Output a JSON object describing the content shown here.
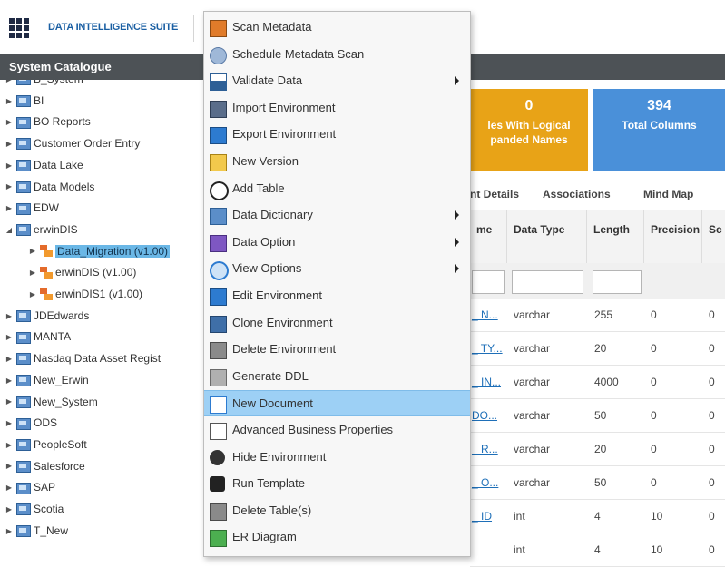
{
  "app": {
    "title": "DATA INTELLIGENCE SUITE"
  },
  "catalogue": {
    "title": "System Catalogue",
    "tree": [
      {
        "label": "B_System",
        "type": "folder",
        "depth": 0,
        "caret": "collapsed"
      },
      {
        "label": "BI",
        "type": "folder",
        "depth": 0,
        "caret": "collapsed"
      },
      {
        "label": "BO Reports",
        "type": "folder",
        "depth": 0,
        "caret": "collapsed"
      },
      {
        "label": "Customer Order Entry",
        "type": "folder",
        "depth": 0,
        "caret": "collapsed"
      },
      {
        "label": "Data Lake",
        "type": "folder",
        "depth": 0,
        "caret": "collapsed"
      },
      {
        "label": "Data Models",
        "type": "folder",
        "depth": 0,
        "caret": "collapsed"
      },
      {
        "label": "EDW",
        "type": "folder",
        "depth": 0,
        "caret": "collapsed"
      },
      {
        "label": "erwinDIS",
        "type": "folder",
        "depth": 0,
        "caret": "expanded"
      },
      {
        "label": "Data_Migration (v1.00)",
        "type": "model",
        "depth": 1,
        "caret": "collapsed",
        "selected": true
      },
      {
        "label": "erwinDIS (v1.00)",
        "type": "model",
        "depth": 1,
        "caret": "collapsed"
      },
      {
        "label": "erwinDIS1 (v1.00)",
        "type": "model",
        "depth": 1,
        "caret": "collapsed"
      },
      {
        "label": "JDEdwards",
        "type": "folder",
        "depth": 0,
        "caret": "collapsed"
      },
      {
        "label": "MANTA",
        "type": "folder",
        "depth": 0,
        "caret": "collapsed"
      },
      {
        "label": "Nasdaq Data Asset Regist",
        "type": "folder",
        "depth": 0,
        "caret": "collapsed"
      },
      {
        "label": "New_Erwin",
        "type": "folder",
        "depth": 0,
        "caret": "collapsed"
      },
      {
        "label": "New_System",
        "type": "folder",
        "depth": 0,
        "caret": "collapsed"
      },
      {
        "label": "ODS",
        "type": "folder",
        "depth": 0,
        "caret": "collapsed"
      },
      {
        "label": "PeopleSoft",
        "type": "folder",
        "depth": 0,
        "caret": "collapsed"
      },
      {
        "label": "Salesforce",
        "type": "folder",
        "depth": 0,
        "caret": "collapsed"
      },
      {
        "label": "SAP",
        "type": "folder",
        "depth": 0,
        "caret": "collapsed"
      },
      {
        "label": "Scotia",
        "type": "folder",
        "depth": 0,
        "caret": "collapsed"
      },
      {
        "label": "T_New",
        "type": "folder",
        "depth": 0,
        "caret": "collapsed"
      }
    ]
  },
  "cards": [
    {
      "number": "0",
      "caption_line1": "les With Logical",
      "caption_line2": "panded Names",
      "color": "#e8a317"
    },
    {
      "number": "394",
      "caption_line1": "Total Columns",
      "caption_line2": "",
      "color": "#4a90d9"
    }
  ],
  "tabs": [
    "nt Details",
    "Associations",
    "Mind Map"
  ],
  "table": {
    "headers": [
      "me",
      "Data Type",
      "Length",
      "Precision",
      "Sc"
    ],
    "rows": [
      [
        "_ N...",
        "varchar",
        "255",
        "0",
        "0"
      ],
      [
        "_ TY...",
        "varchar",
        "20",
        "0",
        "0"
      ],
      [
        "_ IN...",
        "varchar",
        "4000",
        "0",
        "0"
      ],
      [
        "DO...",
        "varchar",
        "50",
        "0",
        "0"
      ],
      [
        "_ R...",
        "varchar",
        "20",
        "0",
        "0"
      ],
      [
        "_ O...",
        "varchar",
        "50",
        "0",
        "0"
      ],
      [
        "_ ID",
        "int",
        "4",
        "10",
        "0"
      ],
      [
        "",
        "int",
        "4",
        "10",
        "0"
      ]
    ]
  },
  "context_menu": {
    "items": [
      {
        "label": "Scan Metadata",
        "icon": "scan-metadata-icon",
        "submenu": false
      },
      {
        "label": "Schedule Metadata Scan",
        "icon": "clock-icon",
        "submenu": false
      },
      {
        "label": "Validate Data",
        "icon": "bar-chart-icon",
        "submenu": true
      },
      {
        "label": "Import Environment",
        "icon": "import-icon",
        "submenu": false
      },
      {
        "label": "Export Environment",
        "icon": "export-icon",
        "submenu": false
      },
      {
        "label": "New Version",
        "icon": "new-version-icon",
        "submenu": false
      },
      {
        "label": "Add Table",
        "icon": "plus-circle-icon",
        "submenu": false
      },
      {
        "label": "Data Dictionary",
        "icon": "book-icon",
        "submenu": true
      },
      {
        "label": "Data Option",
        "icon": "checklist-icon",
        "submenu": true
      },
      {
        "label": "View Options",
        "icon": "magnifier-icon",
        "submenu": true
      },
      {
        "label": "Edit Environment",
        "icon": "edit-icon",
        "submenu": false
      },
      {
        "label": "Clone Environment",
        "icon": "monitor-icon",
        "submenu": false
      },
      {
        "label": "Delete Environment",
        "icon": "trash-icon",
        "submenu": false
      },
      {
        "label": "Generate DDL",
        "icon": "ddl-icon",
        "submenu": false
      },
      {
        "label": "New Document",
        "icon": "document-icon",
        "submenu": false,
        "highlighted": true
      },
      {
        "label": "Advanced Business Properties",
        "icon": "properties-icon",
        "submenu": false
      },
      {
        "label": "Hide Environment",
        "icon": "eye-icon",
        "submenu": false
      },
      {
        "label": "Run Template",
        "icon": "running-icon",
        "submenu": false
      },
      {
        "label": "Delete Table(s)",
        "icon": "trash-icon",
        "submenu": false
      },
      {
        "label": "ER Diagram",
        "icon": "er-diagram-icon",
        "submenu": false
      }
    ]
  }
}
